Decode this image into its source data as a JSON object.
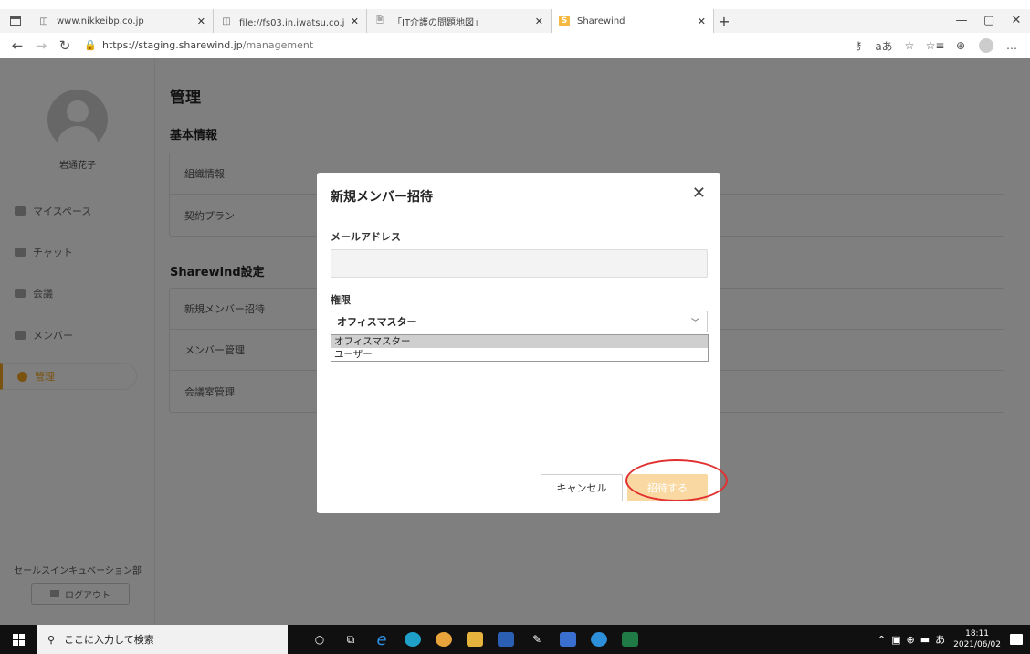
{
  "browser": {
    "tabs": [
      {
        "title": "www.nikkeibp.co.jp",
        "active": false
      },
      {
        "title": "file://fs03.in.iwatsu.co.jp/セールス",
        "active": false
      },
      {
        "title": "「IT介護の問題地図」",
        "active": false
      },
      {
        "title": "Sharewind",
        "active": true
      }
    ],
    "new_tab": "+",
    "url_host": "https://staging.sharewind.jp",
    "url_path": "/management",
    "window_controls": [
      "—",
      "▢",
      "✕"
    ]
  },
  "sidebar": {
    "user_name": "岩通花子",
    "items": [
      {
        "label": "マイスペース",
        "icon": "myspace-icon"
      },
      {
        "label": "チャット",
        "icon": "chat-icon"
      },
      {
        "label": "会議",
        "icon": "meeting-icon"
      },
      {
        "label": "メンバー",
        "icon": "members-icon"
      },
      {
        "label": "管理",
        "icon": "gear-icon",
        "active": true
      }
    ],
    "department": "セールスインキュベーション部",
    "logout_label": "ログアウト"
  },
  "main": {
    "title": "管理",
    "basic_section": {
      "title": "基本情報",
      "rows": [
        "組織情報",
        "契約プラン"
      ]
    },
    "settings_section": {
      "title": "Sharewind設定",
      "rows": [
        "新規メンバー招待",
        "メンバー管理",
        "会議室管理"
      ]
    }
  },
  "modal": {
    "title": "新規メンバー招待",
    "email_label": "メールアドレス",
    "email_value": "",
    "role_label": "権限",
    "role_selected": "オフィスマスター",
    "role_options": [
      "オフィスマスター",
      "ユーザー"
    ],
    "cancel_label": "キャンセル",
    "invite_label": "招待する",
    "invite_color": "#f9d9a1"
  },
  "taskbar": {
    "search_placeholder": "ここに入力して検索",
    "ime": "あ",
    "time": "18:11",
    "date": "2021/06/02"
  }
}
